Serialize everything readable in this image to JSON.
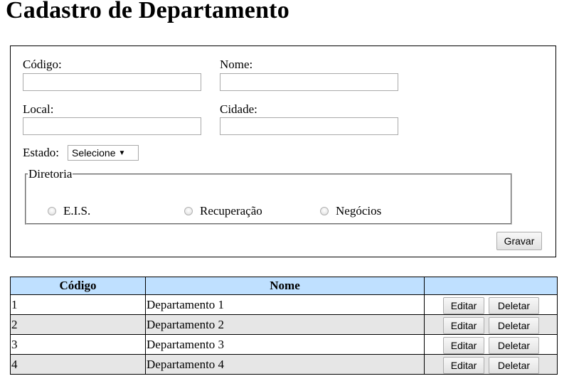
{
  "page": {
    "title": "Cadastro de Departamento"
  },
  "form": {
    "codigo_label": "Código:",
    "codigo_value": "",
    "nome_label": "Nome:",
    "nome_value": "",
    "local_label": "Local:",
    "local_value": "",
    "cidade_label": "Cidade:",
    "cidade_value": "",
    "estado_label": "Estado:",
    "estado_selected": "Selecione",
    "diretoria": {
      "legend": "Diretoria",
      "options": [
        {
          "label": "E.I.S.",
          "checked": false
        },
        {
          "label": "Recuperação",
          "checked": false
        },
        {
          "label": "Negócios",
          "checked": false
        }
      ]
    },
    "save_label": "Gravar"
  },
  "table": {
    "headers": [
      "Código",
      "Nome",
      ""
    ],
    "rows": [
      {
        "codigo": "1",
        "nome": "Departamento 1",
        "edit": "Editar",
        "delete": "Deletar"
      },
      {
        "codigo": "2",
        "nome": "Departamento 2",
        "edit": "Editar",
        "delete": "Deletar"
      },
      {
        "codigo": "3",
        "nome": "Departamento 3",
        "edit": "Editar",
        "delete": "Deletar"
      },
      {
        "codigo": "4",
        "nome": "Departamento 4",
        "edit": "Editar",
        "delete": "Deletar"
      }
    ]
  },
  "colors": {
    "header_bg": "#bfe0ff",
    "alt_row_bg": "#e6e6e6"
  }
}
